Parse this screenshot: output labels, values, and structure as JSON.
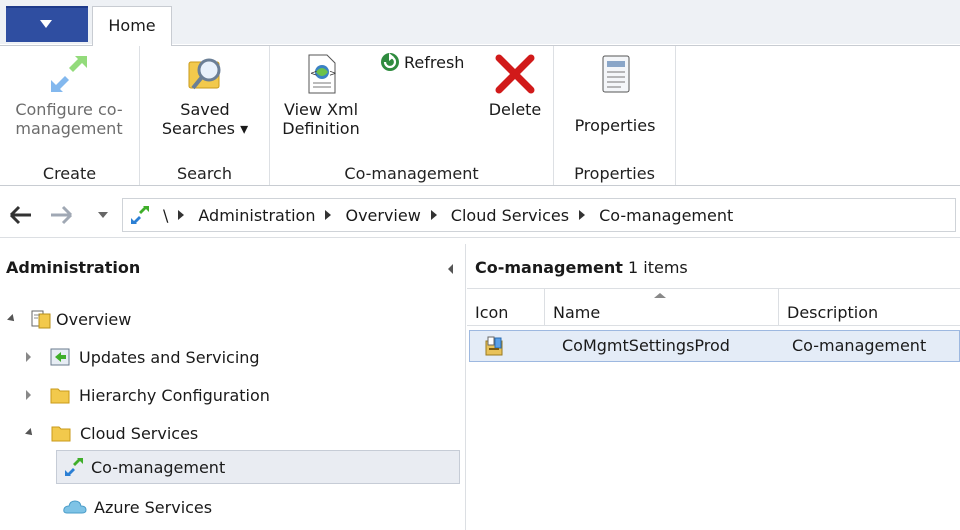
{
  "ribbon": {
    "app_button_icon": "chevron-down-icon",
    "tabs": [
      {
        "label": "Home"
      }
    ],
    "groups": {
      "create": {
        "label": "Create",
        "configure_label": "Configure co-\nmanagement",
        "configure_icon": "configure-comanagement-icon"
      },
      "search": {
        "label": "Search",
        "saved_searches_label": "Saved\nSearches ▾",
        "saved_searches_icon": "saved-searches-icon"
      },
      "comanagement": {
        "label": "Co-management",
        "view_xml_label": "View Xml\nDefinition",
        "view_xml_icon": "xml-document-icon",
        "refresh_label": "Refresh",
        "refresh_icon": "refresh-icon",
        "delete_label": "Delete",
        "delete_icon": "delete-x-icon"
      },
      "properties": {
        "label": "Properties",
        "properties_label": "Properties",
        "properties_icon": "properties-icon"
      }
    }
  },
  "address_bar": {
    "breadcrumbs": [
      "\\",
      "Administration",
      "Overview",
      "Cloud Services",
      "Co-management"
    ]
  },
  "navigation": {
    "title": "Administration",
    "tree": [
      {
        "label": "Overview",
        "icon": "overview-icon",
        "expanded": true
      },
      {
        "label": "Updates and Servicing",
        "icon": "updates-icon",
        "expanded": false
      },
      {
        "label": "Hierarchy Configuration",
        "icon": "folder-icon",
        "expanded": false
      },
      {
        "label": "Cloud Services",
        "icon": "folder-icon",
        "expanded": true
      },
      {
        "label": "Co-management",
        "icon": "comanagement-icon",
        "selected": true
      },
      {
        "label": "Azure Services",
        "icon": "cloud-icon"
      }
    ]
  },
  "content": {
    "title": "Co-management",
    "item_count": "1 items",
    "columns": [
      "Icon",
      "Name",
      "Description"
    ],
    "rows": [
      {
        "icon": "settings-package-icon",
        "name": "CoMgmtSettingsProd",
        "description": "Co-management"
      }
    ]
  },
  "colors": {
    "app_button": "#2f4ea1",
    "selection_bg": "#e4ecf7",
    "selection_border": "#9db8e0",
    "delete_red": "#d11a1a",
    "refresh_green": "#2e8b3e",
    "folder_yellow": "#f2c94c"
  }
}
